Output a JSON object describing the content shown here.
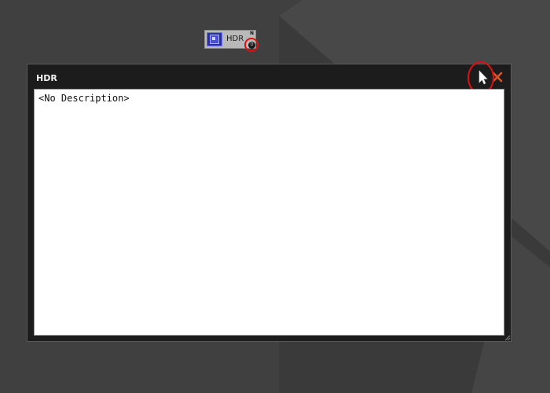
{
  "node": {
    "label": "HDR",
    "flag_top": "N",
    "flag_bottom": "D"
  },
  "dialog": {
    "title": "HDR",
    "description": "<No Description>"
  },
  "colors": {
    "highlight": "#dd1111",
    "close_icon": "#d2552b",
    "node_icon": "#2b2f9a"
  },
  "icons": {
    "pointer": "pointer-cursor-icon",
    "close": "close-icon",
    "node": "hdr-node-icon"
  }
}
